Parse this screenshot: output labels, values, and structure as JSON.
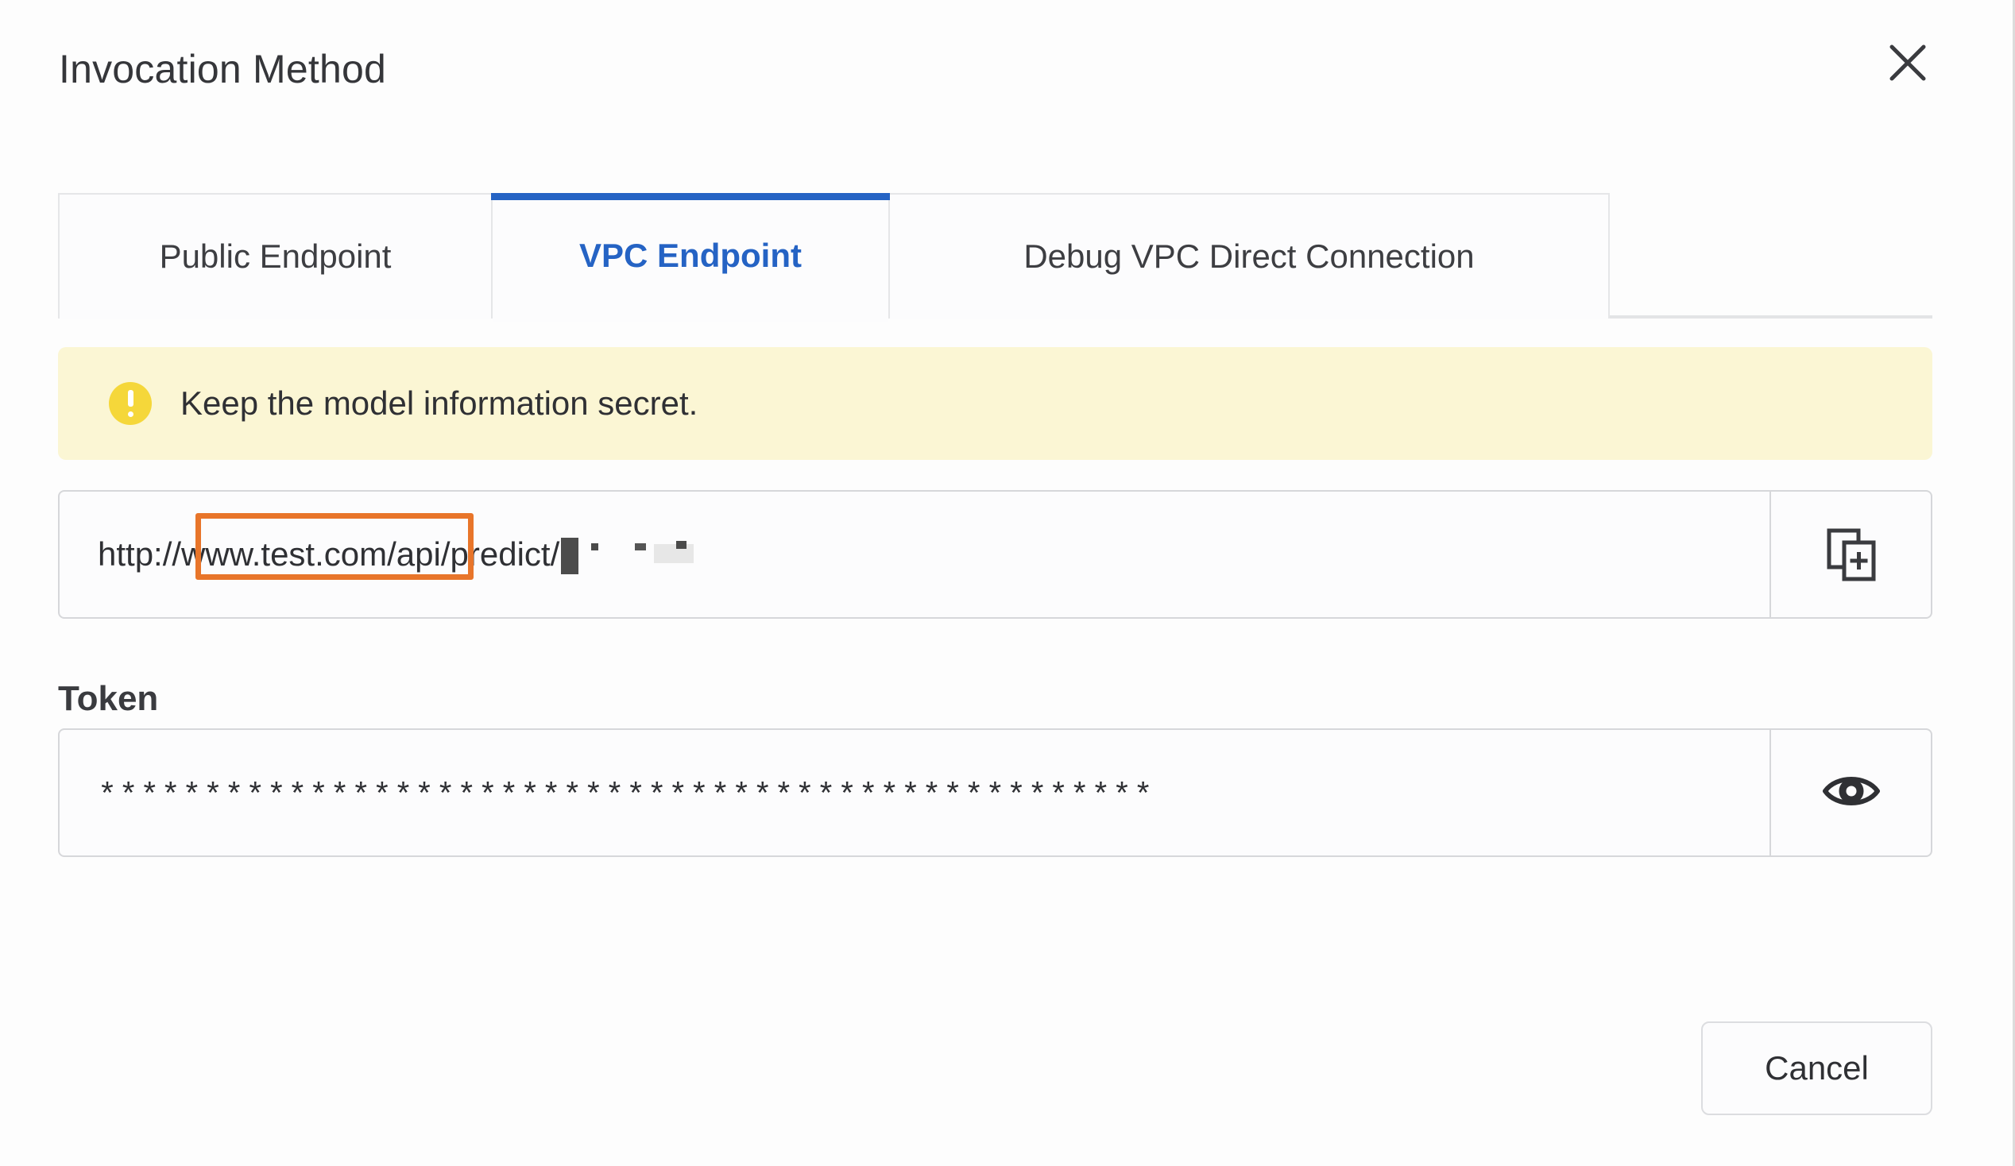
{
  "dialog": {
    "title": "Invocation Method",
    "close_icon": "close-icon"
  },
  "tabs": [
    {
      "label": "Public Endpoint",
      "active": false
    },
    {
      "label": "VPC Endpoint",
      "active": true
    },
    {
      "label": "Debug VPC Direct Connection",
      "active": false
    }
  ],
  "warning": {
    "icon": "warning-exclamation-icon",
    "text": "Keep the model information secret."
  },
  "endpoint": {
    "label": "",
    "url_visible": "http://www.test.com/api/predict/",
    "url_redacted_suffix": "█· · ·",
    "copy_icon": "copy-icon",
    "annotation": {
      "highlights": "/www.test.com/",
      "color": "#e8752a"
    }
  },
  "token": {
    "label": "Token",
    "value": "**************************************************",
    "masked": true,
    "toggle_icon": "eye-icon"
  },
  "footer": {
    "cancel_label": "Cancel"
  },
  "colors": {
    "accent_blue": "#2563c4",
    "warning_bg": "#fbf6d4",
    "warning_icon": "#f5d73a",
    "annotation_orange": "#e8752a",
    "border": "#d6d7da",
    "text": "#2f3034"
  }
}
